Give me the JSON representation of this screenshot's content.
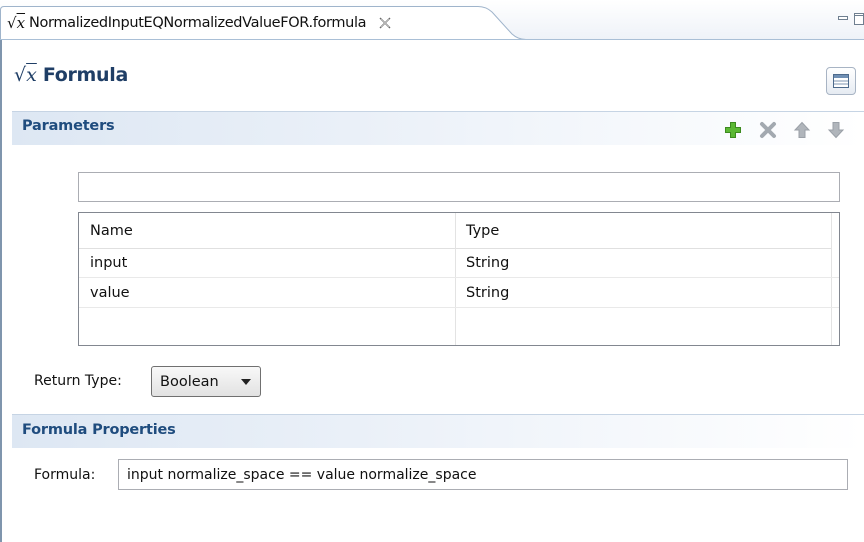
{
  "tab": {
    "title": "NormalizedInputEQNormalizedValueFOR.formula",
    "icon": "sqrt-x-icon"
  },
  "header": {
    "title": "Formula"
  },
  "parameters": {
    "title": "Parameters",
    "filter_value": "",
    "columns": [
      "Name",
      "Type"
    ],
    "rows": [
      {
        "name": "input",
        "type": "String"
      },
      {
        "name": "value",
        "type": "String"
      }
    ]
  },
  "return_type": {
    "label": "Return Type:",
    "value": "Boolean"
  },
  "formula_properties": {
    "title": "Formula Properties",
    "formula_label": "Formula:",
    "formula_value": "input normalize_space == value normalize_space"
  },
  "colors": {
    "accent": "#1f4c7e",
    "add_green": "#4ea72c",
    "disabled_gray": "#a8adb3"
  }
}
